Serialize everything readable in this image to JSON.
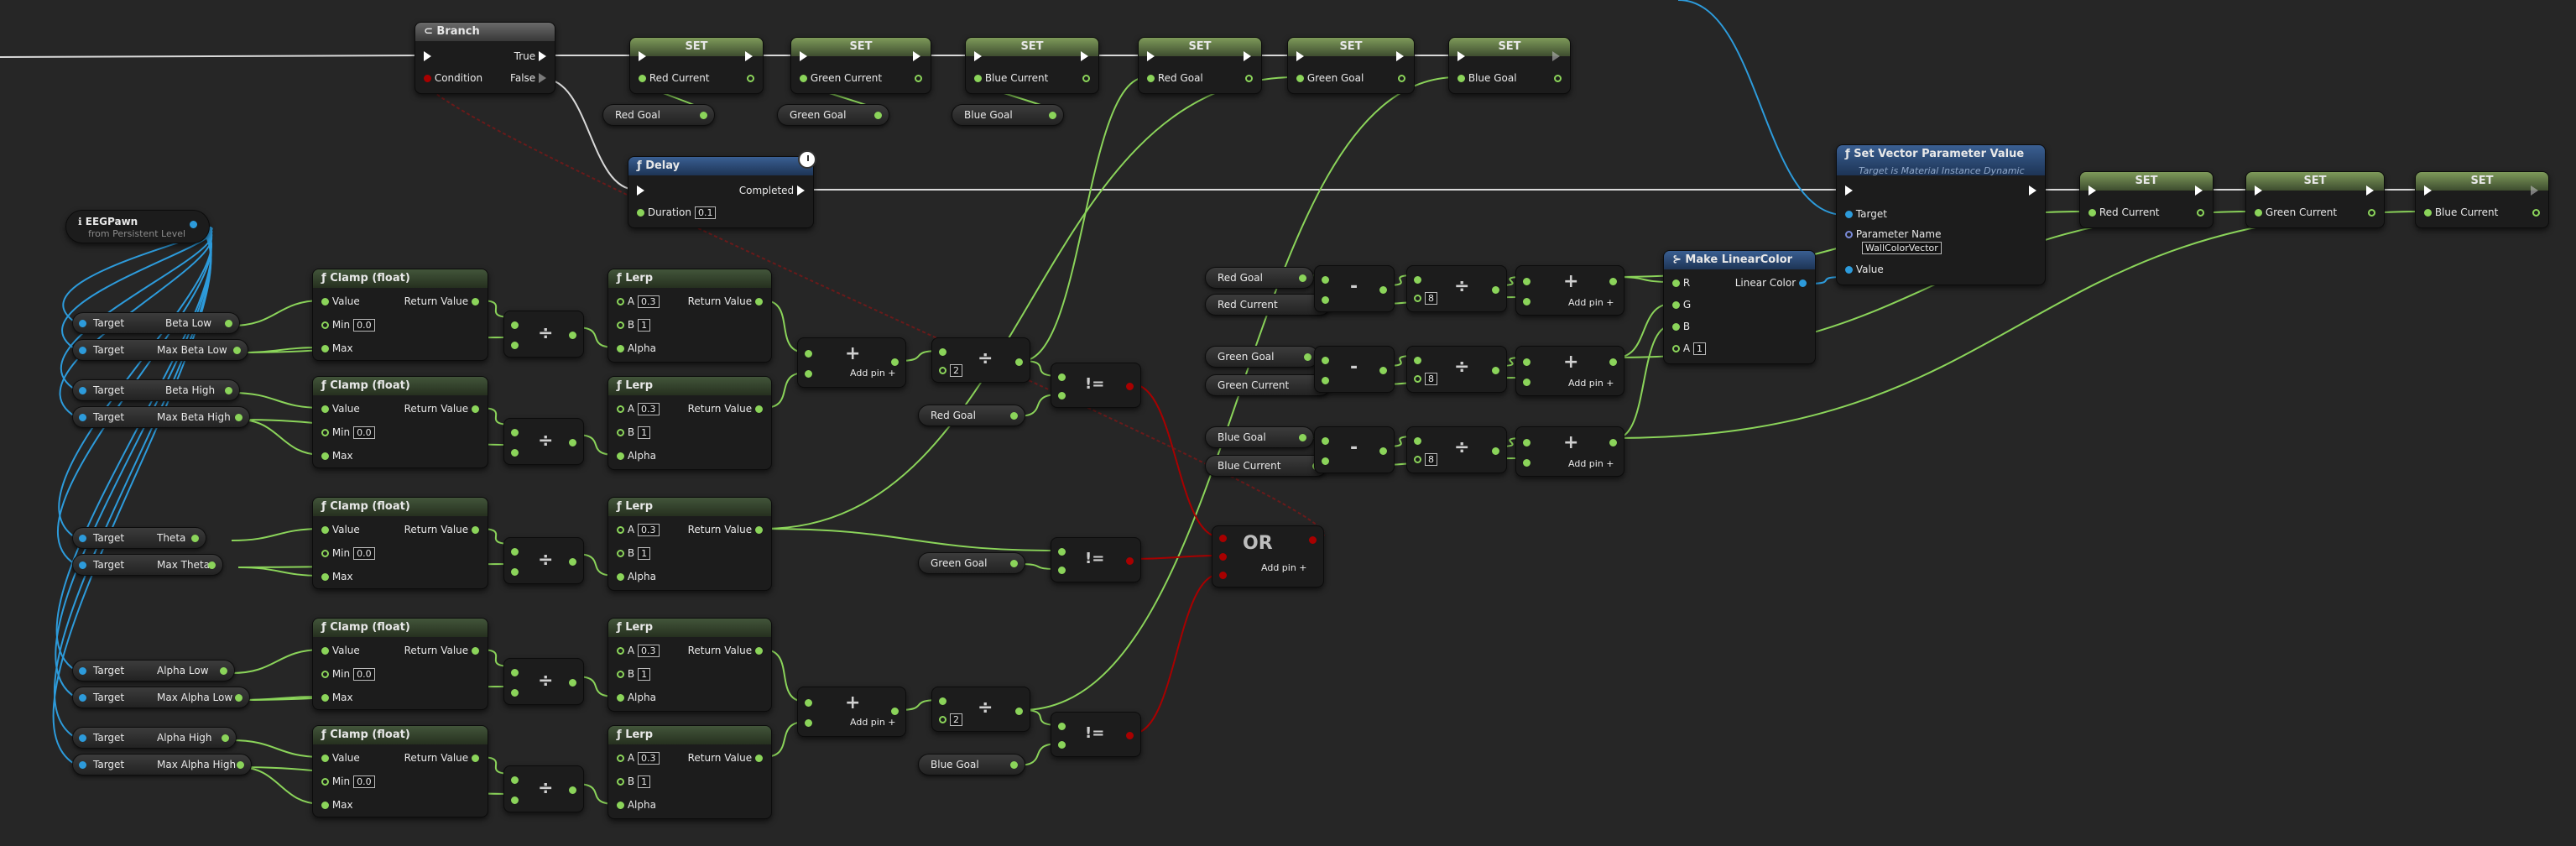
{
  "colors": {
    "background": "#262626",
    "exec_wire": "#d9d9d9",
    "float_pin": "#8bd45a",
    "object_pin": "#2d9bdb",
    "bool_pin": "#a80000",
    "function_header": "#42553a",
    "set_header": "#7e9a5a",
    "blue_header": "#3a5f92"
  },
  "branch": {
    "title": "Branch",
    "condition": "Condition",
    "true": "True",
    "false": "False"
  },
  "delay": {
    "title": "Delay",
    "duration": "Duration",
    "duration_value": "0.1",
    "completed": "Completed"
  },
  "eegpawn": {
    "title": "EEGPawn",
    "subtitle": "from Persistent Level"
  },
  "set_title": "SET",
  "top_sets": [
    {
      "label": "Red Current",
      "var": "Red Goal"
    },
    {
      "label": "Green Current",
      "var": "Green Goal"
    },
    {
      "label": "Blue Current",
      "var": "Blue Goal"
    },
    {
      "label": "Red Goal"
    },
    {
      "label": "Green Goal"
    },
    {
      "label": "Blue Goal"
    }
  ],
  "target_label": "Target",
  "targets": [
    "Beta Low",
    "Max Beta Low",
    "Beta High",
    "Max Beta High",
    "Theta",
    "Max Theta",
    "Alpha Low",
    "Max Alpha Low",
    "Alpha High",
    "Max Alpha High"
  ],
  "clamp": {
    "title": "Clamp (float)",
    "value": "Value",
    "min": "Min",
    "min_value": "0.0",
    "max": "Max",
    "return": "Return Value"
  },
  "lerp": {
    "title": "Lerp",
    "a": "A",
    "a_value": "0.3",
    "b": "B",
    "b_value": "1",
    "alpha": "Alpha",
    "return": "Return Value"
  },
  "add_pin": "Add pin",
  "divide_const": "2",
  "neq_symbol": "!=",
  "goal_vars": [
    "Red Goal",
    "Green Goal",
    "Blue Goal"
  ],
  "or_node": {
    "title": "OR",
    "add_pin": "Add pin"
  },
  "color_rows": [
    {
      "goal": "Red Goal",
      "current": "Red Current"
    },
    {
      "goal": "Green Goal",
      "current": "Green Current"
    },
    {
      "goal": "Blue Goal",
      "current": "Blue Current"
    }
  ],
  "color_divisor": "8",
  "make_linear_color": {
    "title": "Make LinearColor",
    "r": "R",
    "g": "G",
    "b": "B",
    "a": "A",
    "a_value": "1",
    "out": "Linear Color"
  },
  "set_vector": {
    "title": "Set Vector Parameter Value",
    "subtitle": "Target is Material Instance Dynamic",
    "target": "Target",
    "param_name": "Parameter Name",
    "param_value": "WallColorVector",
    "value": "Value"
  },
  "final_sets": [
    "Red Current",
    "Green Current",
    "Blue Current"
  ]
}
